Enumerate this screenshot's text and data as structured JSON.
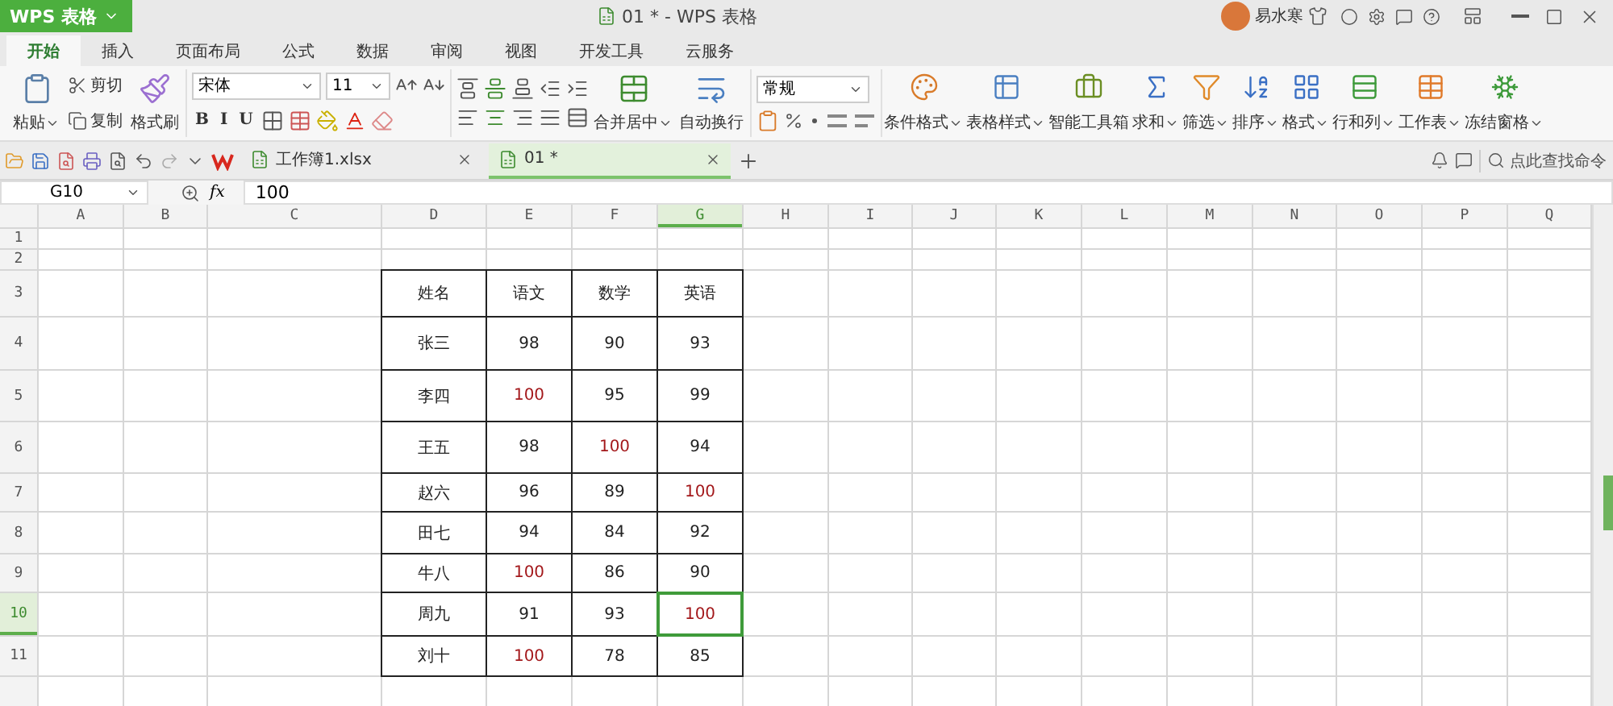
{
  "title_bar": {
    "app_menu": "WPS 表格",
    "title": "01 * - WPS 表格",
    "user": "易水寒"
  },
  "ribbon_tabs": [
    {
      "label": "开始",
      "selected": true
    },
    {
      "label": "插入",
      "selected": false
    },
    {
      "label": "页面布局",
      "selected": false
    },
    {
      "label": "公式",
      "selected": false
    },
    {
      "label": "数据",
      "selected": false
    },
    {
      "label": "审阅",
      "selected": false
    },
    {
      "label": "视图",
      "selected": false
    },
    {
      "label": "开发工具",
      "selected": false
    },
    {
      "label": "云服务",
      "selected": false
    }
  ],
  "clipboard": {
    "paste": "粘贴",
    "cut": "剪切",
    "copy": "复制",
    "format_painter": "格式刷"
  },
  "font": {
    "name": "宋体",
    "size": "11",
    "styles": [
      "B",
      "I",
      "U"
    ]
  },
  "alignment": {
    "merge": "合并居中",
    "wrap": "自动换行"
  },
  "number_format": {
    "value": "常规"
  },
  "tools": [
    {
      "label": "条件格式",
      "dropdown": true
    },
    {
      "label": "表格样式",
      "dropdown": true
    },
    {
      "label": "智能工具箱",
      "dropdown": false
    },
    {
      "label": "求和",
      "dropdown": true
    },
    {
      "label": "筛选",
      "dropdown": true
    },
    {
      "label": "排序",
      "dropdown": true
    },
    {
      "label": "格式",
      "dropdown": true
    },
    {
      "label": "行和列",
      "dropdown": true
    },
    {
      "label": "工作表",
      "dropdown": true
    },
    {
      "label": "冻结窗格",
      "dropdown": true
    }
  ],
  "doc_tabs": [
    {
      "label": "工作簿1.xlsx",
      "selected": false
    },
    {
      "label": "01 *",
      "selected": true
    }
  ],
  "command_search": {
    "placeholder": "点此查找命令"
  },
  "formula_bar": {
    "cell_ref": "G10",
    "fx": "fx",
    "value": "100"
  },
  "columns": [
    {
      "label": "A",
      "selected": false
    },
    {
      "label": "B",
      "selected": false
    },
    {
      "label": "C",
      "selected": false
    },
    {
      "label": "D",
      "selected": false
    },
    {
      "label": "E",
      "selected": false
    },
    {
      "label": "F",
      "selected": false
    },
    {
      "label": "G",
      "selected": true
    },
    {
      "label": "H",
      "selected": false
    },
    {
      "label": "I",
      "selected": false
    },
    {
      "label": "J",
      "selected": false
    },
    {
      "label": "K",
      "selected": false
    },
    {
      "label": "L",
      "selected": false
    },
    {
      "label": "M",
      "selected": false
    },
    {
      "label": "N",
      "selected": false
    },
    {
      "label": "O",
      "selected": false
    },
    {
      "label": "P",
      "selected": false
    },
    {
      "label": "Q",
      "selected": false
    }
  ],
  "row_headers": [
    {
      "label": "1",
      "selected": false
    },
    {
      "label": "2",
      "selected": false
    },
    {
      "label": "3",
      "selected": false
    },
    {
      "label": "4",
      "selected": false
    },
    {
      "label": "5",
      "selected": false
    },
    {
      "label": "6",
      "selected": false
    },
    {
      "label": "7",
      "selected": false
    },
    {
      "label": "8",
      "selected": false
    },
    {
      "label": "9",
      "selected": false
    },
    {
      "label": "10",
      "selected": true
    },
    {
      "label": "11",
      "selected": false
    }
  ],
  "table": {
    "header": [
      "姓名",
      "语文",
      "数学",
      "英语"
    ],
    "rows": [
      [
        {
          "text": "张三",
          "flagged": false,
          "selected": false
        },
        {
          "text": "98",
          "flagged": false,
          "selected": false
        },
        {
          "text": "90",
          "flagged": false,
          "selected": false
        },
        {
          "text": "93",
          "flagged": false,
          "selected": false
        }
      ],
      [
        {
          "text": "李四",
          "flagged": false,
          "selected": false
        },
        {
          "text": "100",
          "flagged": true,
          "selected": false
        },
        {
          "text": "95",
          "flagged": false,
          "selected": false
        },
        {
          "text": "99",
          "flagged": false,
          "selected": false
        }
      ],
      [
        {
          "text": "王五",
          "flagged": false,
          "selected": false
        },
        {
          "text": "98",
          "flagged": false,
          "selected": false
        },
        {
          "text": "100",
          "flagged": true,
          "selected": false
        },
        {
          "text": "94",
          "flagged": false,
          "selected": false
        }
      ],
      [
        {
          "text": "赵六",
          "flagged": false,
          "selected": false
        },
        {
          "text": "96",
          "flagged": false,
          "selected": false
        },
        {
          "text": "89",
          "flagged": false,
          "selected": false
        },
        {
          "text": "100",
          "flagged": true,
          "selected": false
        }
      ],
      [
        {
          "text": "田七",
          "flagged": false,
          "selected": false
        },
        {
          "text": "94",
          "flagged": false,
          "selected": false
        },
        {
          "text": "84",
          "flagged": false,
          "selected": false
        },
        {
          "text": "92",
          "flagged": false,
          "selected": false
        }
      ],
      [
        {
          "text": "牛八",
          "flagged": false,
          "selected": false
        },
        {
          "text": "100",
          "flagged": true,
          "selected": false
        },
        {
          "text": "86",
          "flagged": false,
          "selected": false
        },
        {
          "text": "90",
          "flagged": false,
          "selected": false
        }
      ],
      [
        {
          "text": "周九",
          "flagged": false,
          "selected": false
        },
        {
          "text": "91",
          "flagged": false,
          "selected": false
        },
        {
          "text": "93",
          "flagged": false,
          "selected": false
        },
        {
          "text": "100",
          "flagged": true,
          "selected": true
        }
      ],
      [
        {
          "text": "刘十",
          "flagged": false,
          "selected": false
        },
        {
          "text": "100",
          "flagged": true,
          "selected": false
        },
        {
          "text": "78",
          "flagged": false,
          "selected": false
        },
        {
          "text": "85",
          "flagged": false,
          "selected": false
        }
      ]
    ]
  }
}
